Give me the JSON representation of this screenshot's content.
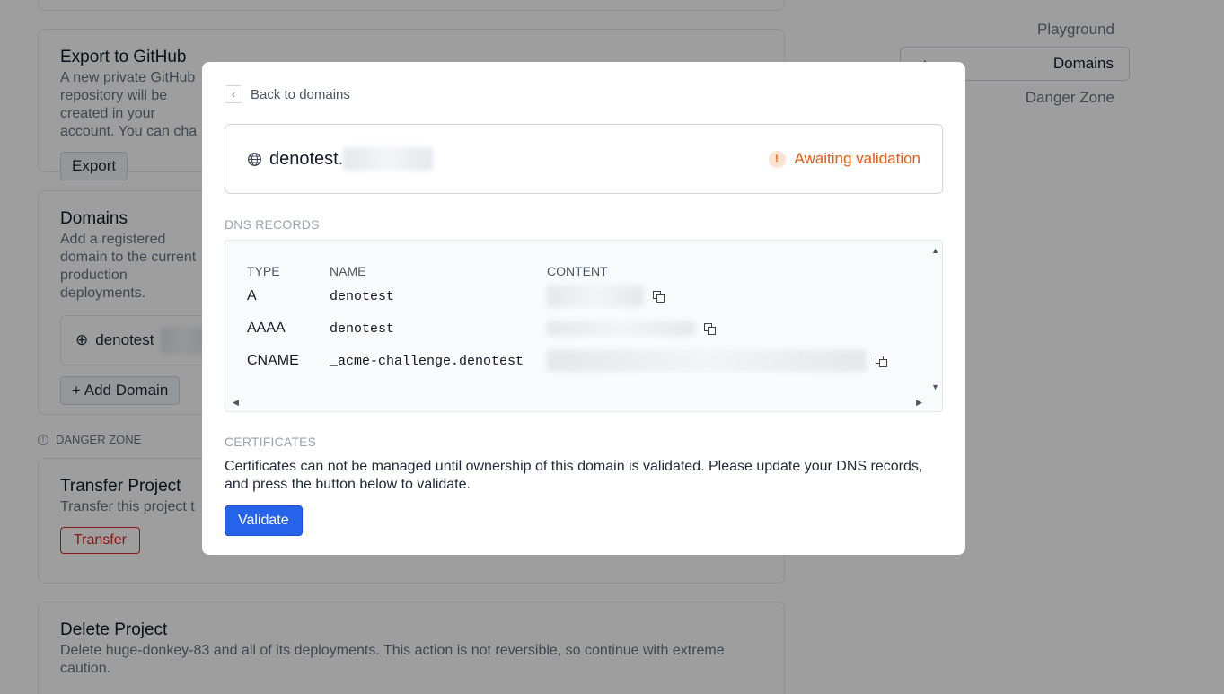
{
  "background": {
    "export_card": {
      "title": "Export to GitHub",
      "description": "A new private GitHub repository will be created in your account. You can cha",
      "button": "Export"
    },
    "domains_card": {
      "title": "Domains",
      "description": "Add a registered domain to the current production deployments.",
      "domain_name": "denotest",
      "add_button": "Add Domain"
    },
    "danger_zone_label": "DANGER ZONE",
    "transfer_card": {
      "title": "Transfer Project",
      "description": "Transfer this project t",
      "button": "Transfer"
    },
    "delete_card": {
      "title": "Delete Project",
      "description": "Delete huge-donkey-83 and all of its deployments. This action is not reversible, so continue with extreme caution."
    },
    "sidenav": {
      "items": [
        "Playground",
        "Domains",
        "Danger Zone"
      ],
      "active": "Domains"
    }
  },
  "modal": {
    "back_label": "Back to domains",
    "domain_name": "denotest.",
    "status": "Awaiting validation",
    "status_color": "#ea580c",
    "dns_section_label": "DNS RECORDS",
    "dns_headers": [
      "TYPE",
      "NAME",
      "CONTENT"
    ],
    "dns_records": [
      {
        "type": "A",
        "name": "denotest"
      },
      {
        "type": "AAAA",
        "name": "denotest"
      },
      {
        "type": "CNAME",
        "name": "_acme-challenge.denotest"
      }
    ],
    "cert_section_label": "CERTIFICATES",
    "cert_text": "Certificates can not be managed until ownership of this domain is validated. Please update your DNS records, and press the button below to validate.",
    "validate_button": "Validate",
    "accent_color": "#2563eb"
  }
}
